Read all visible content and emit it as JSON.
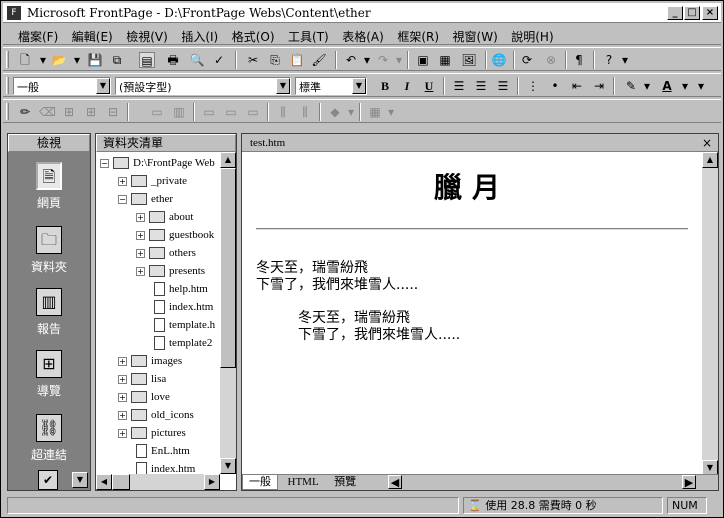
{
  "title": "Microsoft FrontPage - D:\\FrontPage Webs\\Content\\ether",
  "menu": [
    "檔案(F)",
    "編輯(E)",
    "檢視(V)",
    "插入(I)",
    "格式(O)",
    "工具(T)",
    "表格(A)",
    "框架(R)",
    "視窗(W)",
    "說明(H)"
  ],
  "format": {
    "style": "一般",
    "font": "(預設字型)",
    "size": "標準",
    "bold": "B",
    "italic": "I",
    "underline": "U"
  },
  "views": {
    "header": "檢視",
    "items": [
      {
        "label": "網頁",
        "icon": "page-view-icon"
      },
      {
        "label": "資料夾",
        "icon": "folder-view-icon"
      },
      {
        "label": "報告",
        "icon": "reports-view-icon"
      },
      {
        "label": "導覽",
        "icon": "navigation-view-icon"
      },
      {
        "label": "超連結",
        "icon": "hyperlinks-view-icon"
      }
    ]
  },
  "folders": {
    "header": "資料夾清單",
    "items": [
      {
        "label": "D:\\FrontPage Web",
        "type": "root"
      },
      {
        "label": "_private",
        "type": "folder"
      },
      {
        "label": "ether",
        "type": "folder"
      },
      {
        "label": "about",
        "type": "folder"
      },
      {
        "label": "guestbook",
        "type": "folder"
      },
      {
        "label": "others",
        "type": "folder"
      },
      {
        "label": "presents",
        "type": "folder"
      },
      {
        "label": "help.htm",
        "type": "file"
      },
      {
        "label": "index.htm",
        "type": "file"
      },
      {
        "label": "template.h",
        "type": "file"
      },
      {
        "label": "template2",
        "type": "file"
      },
      {
        "label": "images",
        "type": "folder"
      },
      {
        "label": "lisa",
        "type": "folder"
      },
      {
        "label": "love",
        "type": "folder"
      },
      {
        "label": "old_icons",
        "type": "folder"
      },
      {
        "label": "pictures",
        "type": "folder"
      },
      {
        "label": "EnL.htm",
        "type": "file"
      },
      {
        "label": "index.htm",
        "type": "file"
      }
    ]
  },
  "editor": {
    "filename": "test.htm",
    "heading": "臘月",
    "para1": [
      "冬天至，瑞雪紛飛",
      "下雪了，我們來堆雪人....."
    ],
    "para2": [
      "冬天至，瑞雪紛飛",
      "下雪了，我們來堆雪人....."
    ],
    "tabs": [
      "一般",
      "HTML",
      "預覽"
    ]
  },
  "status": {
    "download": "使用 28.8 需費時 0 秒",
    "num": "NUM"
  }
}
